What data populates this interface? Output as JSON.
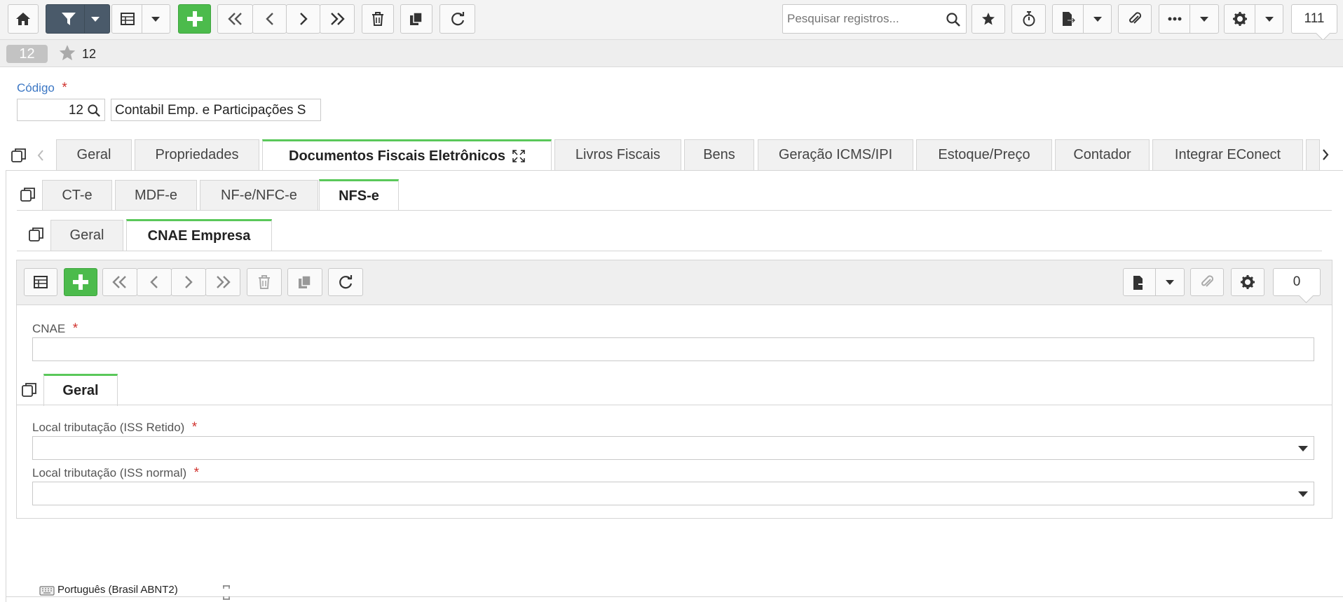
{
  "toolbar": {
    "search_placeholder": "Pesquisar registros...",
    "record_count": "111",
    "icons": [
      "home-icon",
      "filter-icon",
      "grid-icon",
      "add-icon",
      "first-icon",
      "prev-icon",
      "next-icon",
      "last-icon",
      "delete-icon",
      "copy-icon",
      "refresh-icon",
      "star-icon",
      "timer-icon",
      "export-icon",
      "attach-icon",
      "more-icon",
      "gear-icon"
    ]
  },
  "record": {
    "badge": "12",
    "title": "12"
  },
  "form": {
    "codigo_label": "Código",
    "required_mark": "*",
    "codigo_value": "12",
    "descricao_value": "Contabil Emp. e Participações S"
  },
  "main_tabs": [
    {
      "label": "Geral"
    },
    {
      "label": "Propriedades"
    },
    {
      "label": "Documentos Fiscais Eletrônicos",
      "active": true
    },
    {
      "label": "Livros Fiscais"
    },
    {
      "label": "Bens"
    },
    {
      "label": "Geração ICMS/IPI"
    },
    {
      "label": "Estoque/Preço"
    },
    {
      "label": "Contador"
    },
    {
      "label": "Integrar EConect"
    }
  ],
  "doc_tabs": [
    {
      "label": "CT-e"
    },
    {
      "label": "MDF-e"
    },
    {
      "label": "NF-e/NFC-e"
    },
    {
      "label": "NFS-e",
      "active": true
    }
  ],
  "nfse_tabs": [
    {
      "label": "Geral"
    },
    {
      "label": "CNAE Empresa",
      "active": true
    }
  ],
  "sub_toolbar": {
    "record_count": "0"
  },
  "cnae": {
    "label": "CNAE",
    "value": ""
  },
  "inner_tabs": [
    {
      "label": "Geral",
      "active": true
    }
  ],
  "iss_retido": {
    "label": "Local tributação (ISS Retido)",
    "value": ""
  },
  "iss_normal": {
    "label": "Local tributação (ISS normal)",
    "value": ""
  },
  "footer": {
    "keyboard": "Português (Brasil ABNT2)"
  },
  "colors": {
    "accent_green": "#4cbb4c",
    "tab_active": "#5ac85a",
    "label_blue": "#3c77c4",
    "required_red": "#d0312d",
    "dark_button": "#4a5a6a"
  }
}
